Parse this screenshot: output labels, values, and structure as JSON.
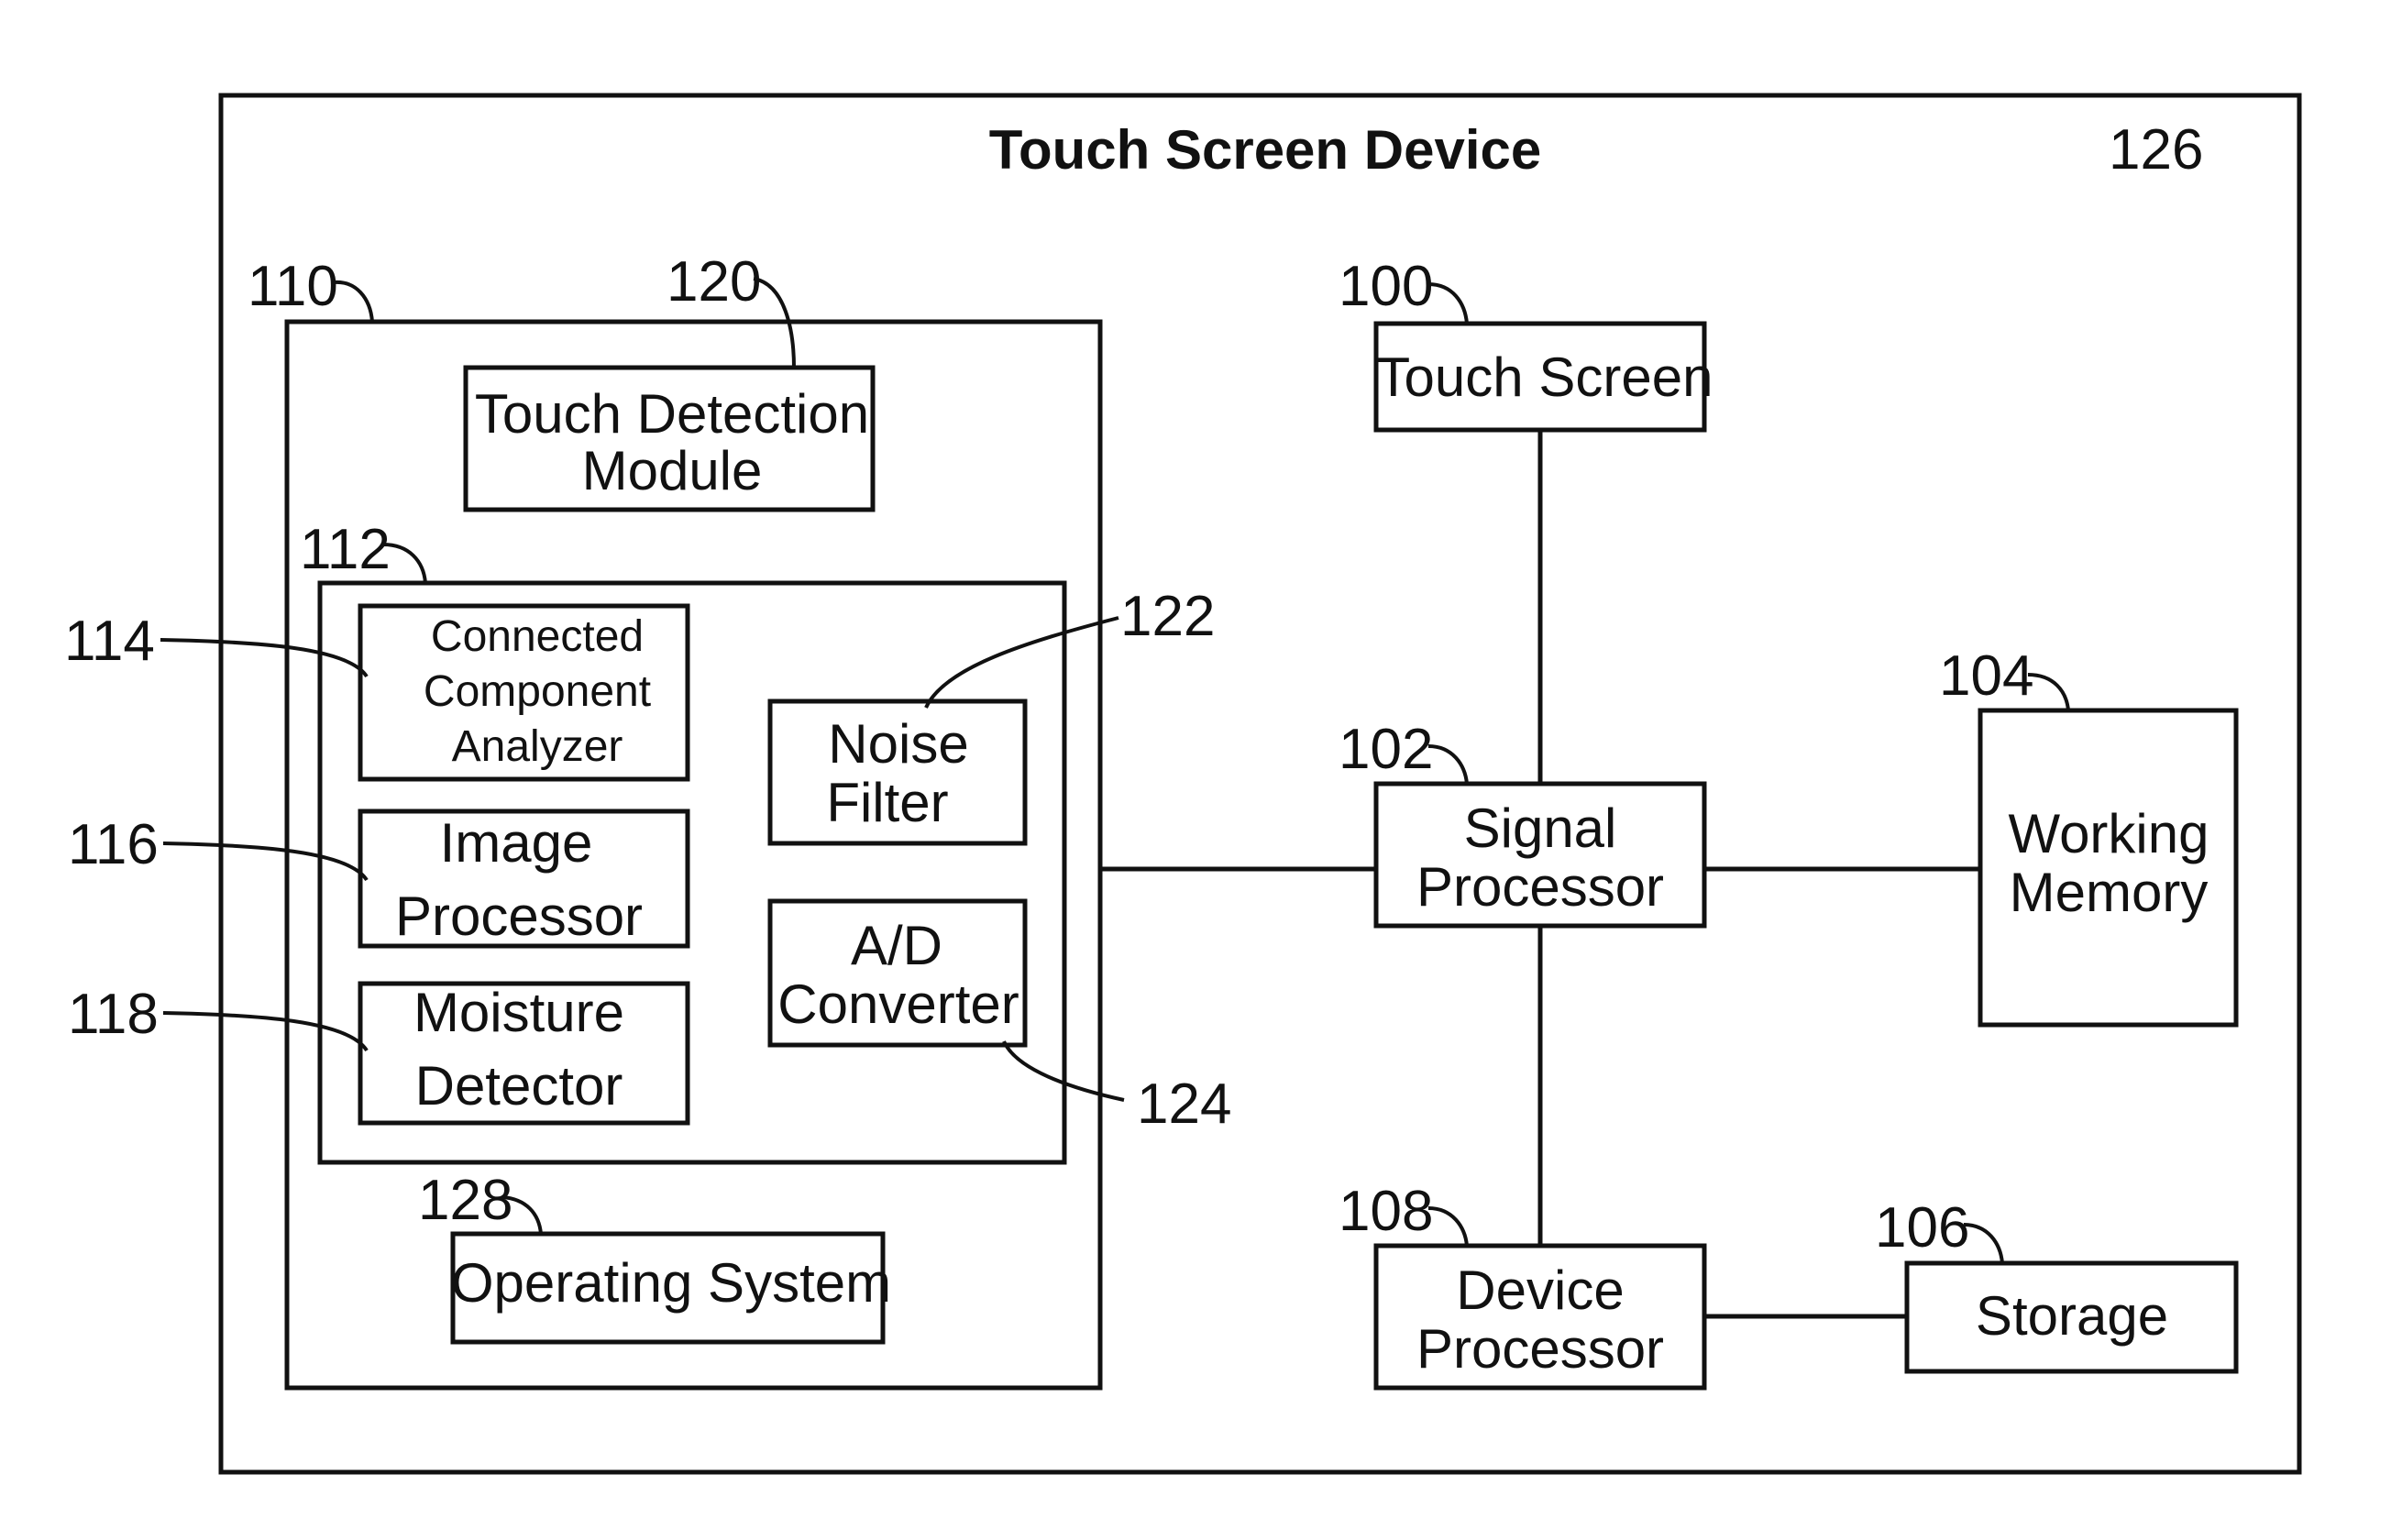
{
  "figure": {
    "title": "Touch Screen Device",
    "title_ref": "126"
  },
  "blocks": {
    "main_module": {
      "ref": "110"
    },
    "touch_detection": {
      "ref": "120",
      "lines": [
        "Touch Detection",
        "Module"
      ]
    },
    "processing_group": {
      "ref": "112"
    },
    "connected_component": {
      "ref": "114",
      "lines": [
        "Connected",
        "Component",
        "Analyzer"
      ]
    },
    "image_processor": {
      "ref": "116",
      "lines": [
        "Image",
        "Processor"
      ]
    },
    "moisture_detector": {
      "ref": "118",
      "lines": [
        "Moisture",
        "Detector"
      ]
    },
    "noise_filter": {
      "ref": "122",
      "lines": [
        "Noise",
        "Filter"
      ]
    },
    "ad_converter": {
      "ref": "124",
      "lines": [
        "A/D",
        "Converter"
      ]
    },
    "operating_system": {
      "ref": "128",
      "lines": [
        "Operating System"
      ]
    },
    "touch_screen": {
      "ref": "100",
      "lines": [
        "Touch Screen"
      ]
    },
    "signal_processor": {
      "ref": "102",
      "lines": [
        "Signal",
        "Processor"
      ]
    },
    "working_memory": {
      "ref": "104",
      "lines": [
        "Working",
        "Memory"
      ]
    },
    "storage": {
      "ref": "106",
      "lines": [
        "Storage"
      ]
    },
    "device_processor": {
      "ref": "108",
      "lines": [
        "Device",
        "Processor"
      ]
    }
  },
  "connections": [
    [
      "main_module",
      "signal_processor"
    ],
    [
      "touch_screen",
      "signal_processor"
    ],
    [
      "signal_processor",
      "working_memory"
    ],
    [
      "signal_processor",
      "device_processor"
    ],
    [
      "device_processor",
      "storage"
    ]
  ]
}
